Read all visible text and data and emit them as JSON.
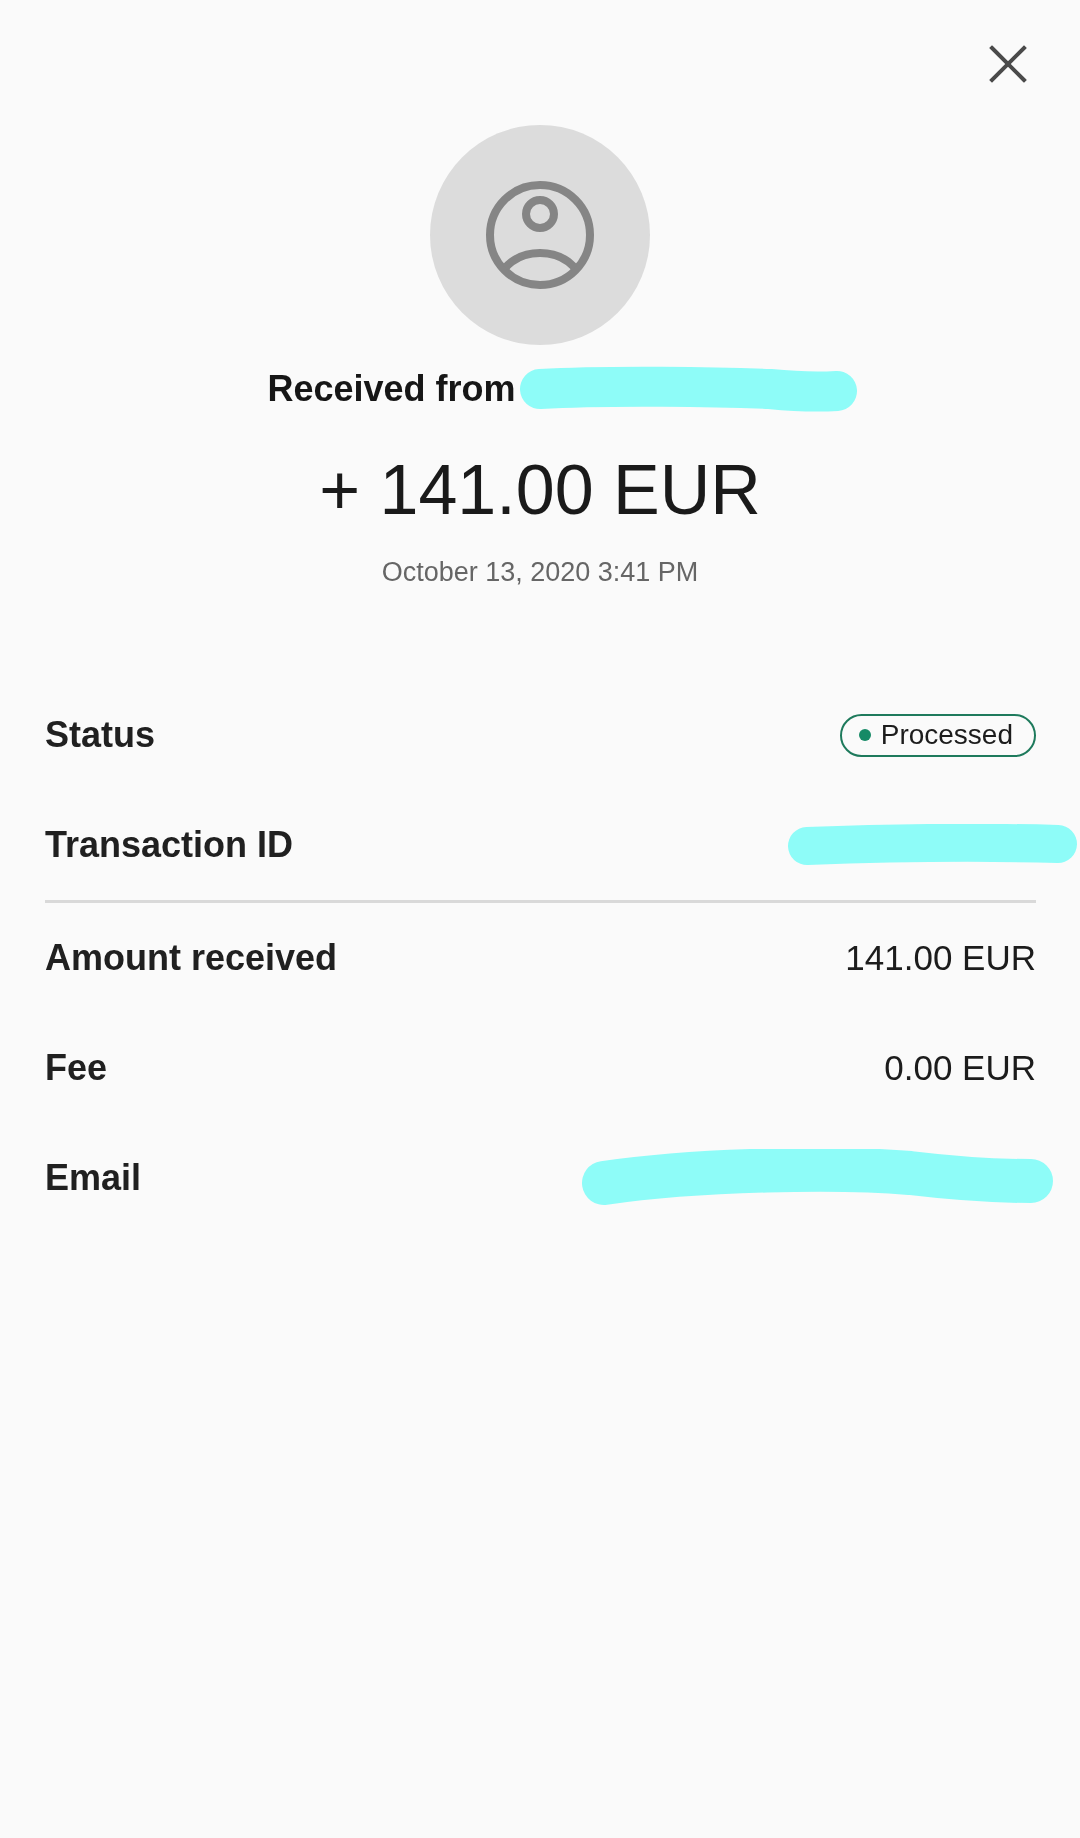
{
  "header": {
    "title": "Received from",
    "title_redacted": true,
    "amount": "+ 141.00 EUR",
    "date": "October 13, 2020 3:41 PM"
  },
  "sections": [
    {
      "rows": [
        {
          "label": "Status",
          "kind": "status",
          "value": "Processed"
        },
        {
          "label": "Transaction ID",
          "kind": "redacted"
        }
      ]
    },
    {
      "rows": [
        {
          "label": "Amount received",
          "kind": "text",
          "value": "141.00 EUR"
        },
        {
          "label": "Fee",
          "kind": "text",
          "value": "0.00 EUR"
        },
        {
          "label": "Email",
          "kind": "redacted"
        }
      ]
    }
  ]
}
